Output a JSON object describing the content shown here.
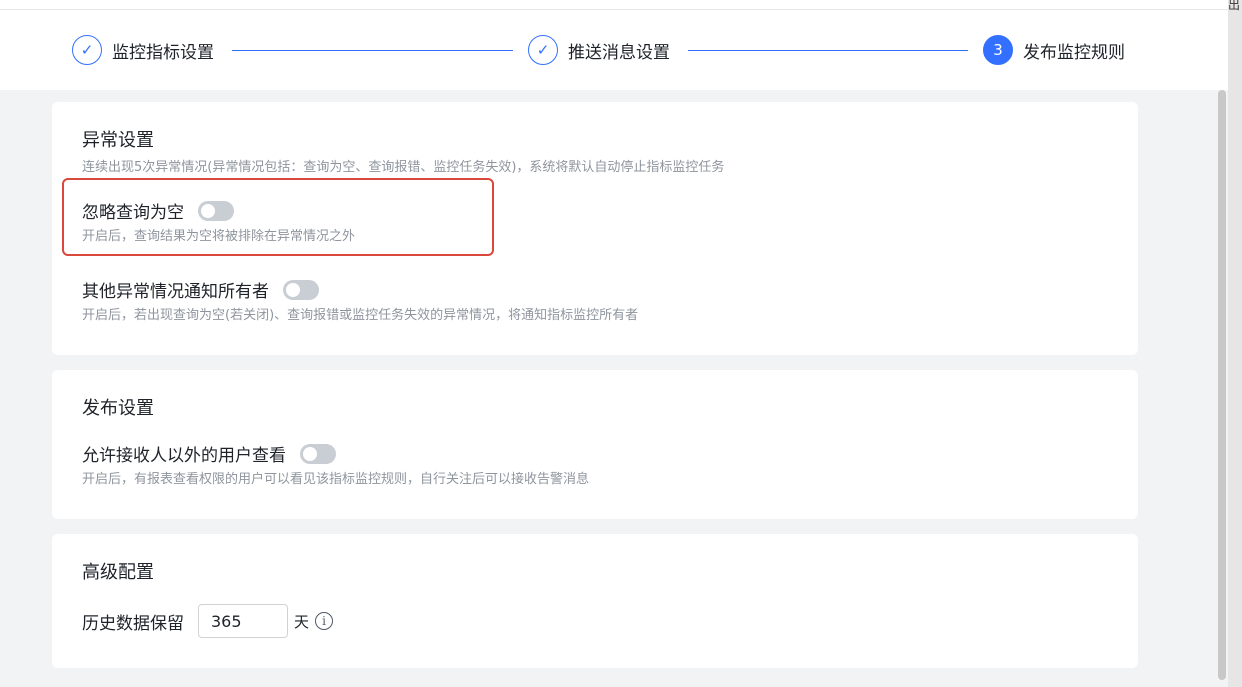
{
  "corner_text": "出",
  "steps": [
    {
      "label": "监控指标设置",
      "state": "done",
      "icon": "check-icon",
      "mark": "✓"
    },
    {
      "label": "推送消息设置",
      "state": "done",
      "icon": "check-icon",
      "mark": "✓"
    },
    {
      "label": "发布监控规则",
      "state": "active",
      "number": "3"
    }
  ],
  "exception_settings": {
    "title": "异常设置",
    "desc": "连续出现5次异常情况(异常情况包括：查询为空、查询报错、监控任务失效)，系统将默认自动停止指标监控任务",
    "ignore_empty": {
      "label": "忽略查询为空",
      "desc": "开启后，查询结果为空将被排除在异常情况之外",
      "enabled": false
    },
    "notify_owners": {
      "label": "其他异常情况通知所有者",
      "desc": "开启后，若出现查询为空(若关闭)、查询报错或监控任务失效的异常情况，将通知指标监控所有者",
      "enabled": false
    }
  },
  "publish_settings": {
    "title": "发布设置",
    "allow_others": {
      "label": "允许接收人以外的用户查看",
      "desc": "开启后，有报表查看权限的用户可以看见该指标监控规则，自行关注后可以接收告警消息",
      "enabled": false
    }
  },
  "advanced": {
    "title": "高级配置",
    "retention_label": "历史数据保留",
    "retention_value": "365",
    "retention_unit": "天",
    "info_mark": "i"
  },
  "colors": {
    "accent": "#3370ff",
    "highlight": "#d9483b",
    "toggle_off": "#c9cdd4"
  }
}
